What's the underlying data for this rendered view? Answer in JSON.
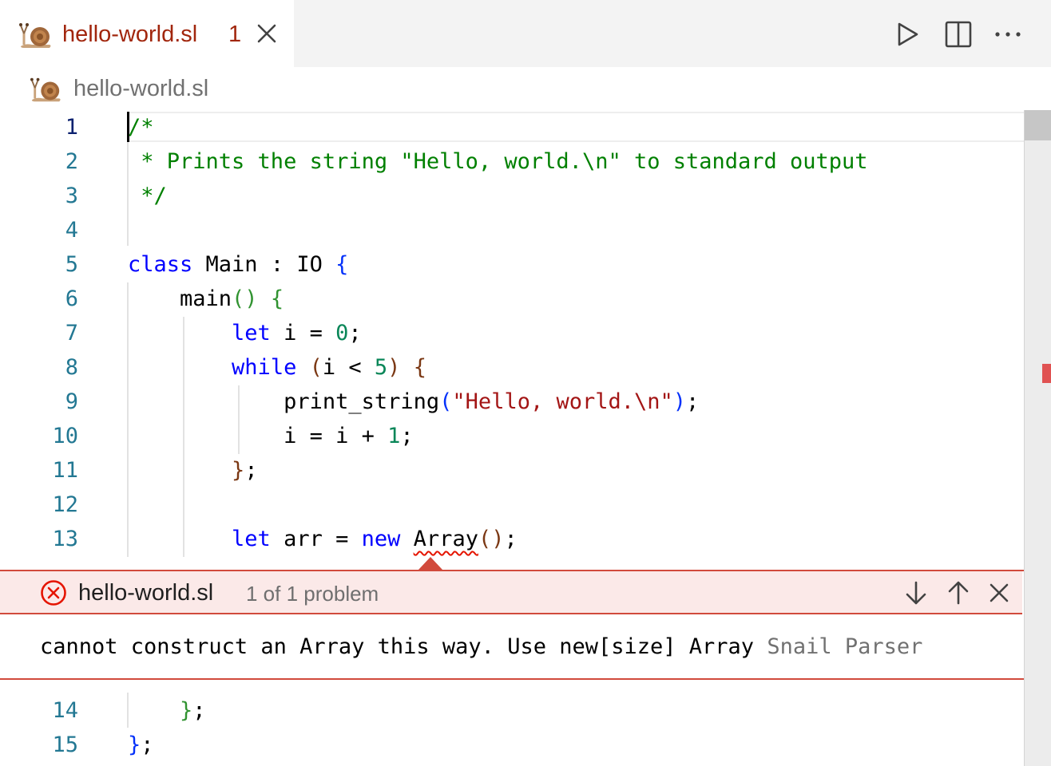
{
  "tab": {
    "title": "hello-world.sl",
    "problem_badge": "1",
    "icon": "snail-icon",
    "title_color": "#a1260d"
  },
  "toolbar": {
    "icons": [
      "run-icon",
      "split-editor-icon",
      "more-actions-icon"
    ]
  },
  "breadcrumb": {
    "file": "hello-world.sl"
  },
  "editor": {
    "active_line": 1,
    "lines": [
      {
        "number": "1",
        "text": "/*"
      },
      {
        "number": "2",
        "text": " * Prints the string \"Hello, world.\\n\" to standard output"
      },
      {
        "number": "3",
        "text": " */"
      },
      {
        "number": "4",
        "text": ""
      },
      {
        "number": "5",
        "text": "class Main : IO {"
      },
      {
        "number": "6",
        "text": "    main() {"
      },
      {
        "number": "7",
        "text": "        let i = 0;"
      },
      {
        "number": "8",
        "text": "        while (i < 5) {"
      },
      {
        "number": "9",
        "text": "            print_string(\"Hello, world.\\n\");"
      },
      {
        "number": "10",
        "text": "            i = i + 1;"
      },
      {
        "number": "11",
        "text": "        };"
      },
      {
        "number": "12",
        "text": ""
      },
      {
        "number": "13",
        "text": "        let arr = new Array();"
      },
      {
        "number": "14",
        "text": "    };"
      },
      {
        "number": "15",
        "text": "};"
      }
    ],
    "tokens": {
      "l1": "/*",
      "l2": " * Prints the string \"Hello, world.\\n\" to standard output",
      "l3": " */",
      "class_kw": "class",
      "class_name": " Main : IO ",
      "brace_open": "{",
      "main_name": "    main",
      "main_parens": "()",
      "main_brace": "{",
      "let_kw": "let",
      "i_assign": " i = ",
      "zero": "0",
      "semi": ";",
      "while_kw": "while",
      "while_open": "(",
      "while_cond": "i < ",
      "five": "5",
      "while_close": ")",
      "while_brace": "{",
      "print_fn": "print_string",
      "print_open": "(",
      "print_str": "\"Hello, world.\\n\"",
      "print_close": ")",
      "inc": "i = i + ",
      "one": "1",
      "close_while": "}",
      "let2_kw": "let",
      "arr_assign": " arr = ",
      "new_kw": "new",
      "array_type": "Array",
      "array_parens": "()",
      "close_main": "}",
      "close_class": "}"
    }
  },
  "problem": {
    "file": "hello-world.sl",
    "count_text": "1 of 1 problem",
    "message": "cannot construct an Array this way. Use new[size] Array",
    "source": "Snail Parser",
    "severity_color": "#d14a3c",
    "icons": [
      "error-icon",
      "next-problem-icon",
      "previous-problem-icon",
      "close-icon"
    ]
  }
}
